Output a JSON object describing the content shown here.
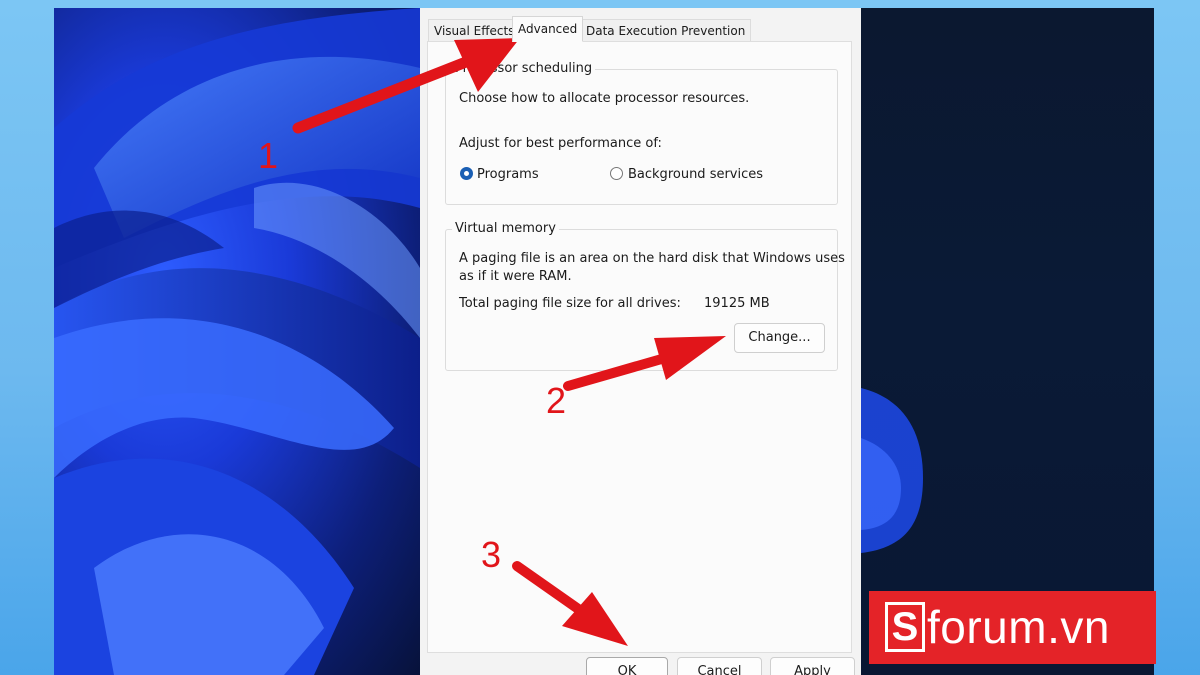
{
  "dialog": {
    "tabs": [
      {
        "label": "Visual Effects",
        "active": false
      },
      {
        "label": "Advanced",
        "active": true
      },
      {
        "label": "Data Execution Prevention",
        "active": false
      }
    ],
    "processor_scheduling": {
      "title": "Processor scheduling",
      "description": "Choose how to allocate processor resources.",
      "adjust_label": "Adjust for best performance of:",
      "options": [
        {
          "label": "Programs",
          "selected": true
        },
        {
          "label": "Background services",
          "selected": false
        }
      ]
    },
    "virtual_memory": {
      "title": "Virtual memory",
      "description_line1": "A paging file is an area on the hard disk that Windows uses",
      "description_line2": "as if it were RAM.",
      "total_label": "Total paging file size for all drives:",
      "total_value": "19125 MB",
      "change_button": "Change..."
    },
    "footer": {
      "ok": "OK",
      "cancel": "Cancel",
      "apply": "Apply"
    }
  },
  "annotations": {
    "step1": "1",
    "step2": "2",
    "step3": "3",
    "arrow_color": "#e1151a"
  },
  "watermark": {
    "logo_letter": "S",
    "text": "forum.vn",
    "background": "#e42328"
  }
}
